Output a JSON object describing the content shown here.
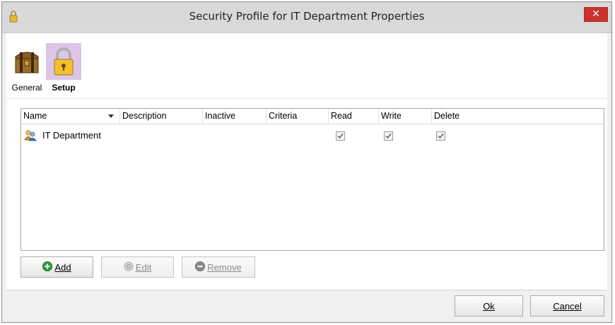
{
  "window": {
    "title": "Security Profile for IT Department Properties",
    "close_label": "✕"
  },
  "toolbar": {
    "general_label": "General",
    "setup_label": "Setup",
    "selected": "Setup"
  },
  "grid": {
    "columns": [
      "Name",
      "Description",
      "Inactive",
      "Criteria",
      "Read",
      "Write",
      "Delete"
    ],
    "sort_column": "Name",
    "rows": [
      {
        "name": "IT Department",
        "read": true,
        "write": true,
        "delete": true
      }
    ]
  },
  "buttons": {
    "add": "Add",
    "edit": "Edit",
    "remove": "Remove",
    "ok": "Ok",
    "cancel": "Cancel"
  },
  "colors": {
    "close_button": "#c9322f",
    "selected_tool": "#dcc5e6",
    "add_icon": "#2e9e3e"
  }
}
